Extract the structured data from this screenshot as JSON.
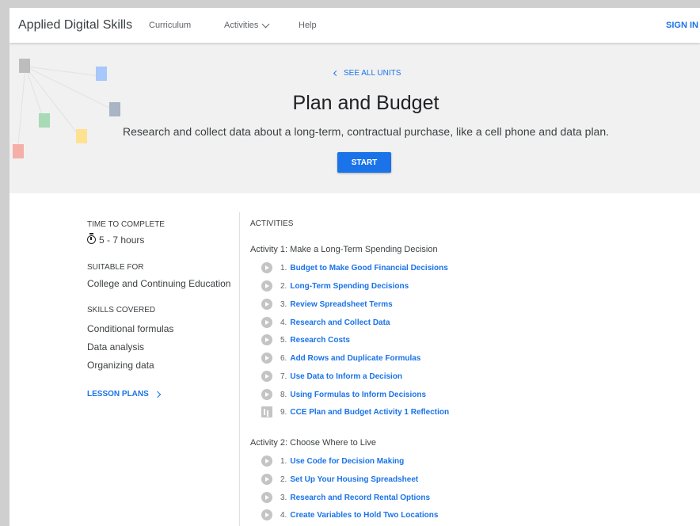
{
  "header": {
    "brand": "Applied Digital Skills",
    "nav": {
      "curriculum": "Curriculum",
      "activities": "Activities",
      "help": "Help"
    },
    "sign_in": "SIGN IN"
  },
  "hero": {
    "see_all": "SEE ALL UNITS",
    "title": "Plan and Budget",
    "subtitle": "Research and collect data about a long-term, contractual purchase, like a cell phone and data plan.",
    "start": "START"
  },
  "details": {
    "time_heading": "TIME TO COMPLETE",
    "time_value": "5 - 7 hours",
    "suitable_heading": "SUITABLE FOR",
    "suitable_value": "College and Continuing Education",
    "skills_heading": "SKILLS COVERED",
    "skills": [
      "Conditional formulas",
      "Data analysis",
      "Organizing data"
    ],
    "lesson_plans": "LESSON PLANS"
  },
  "activities": {
    "heading": "ACTIVITIES",
    "groups": [
      {
        "title": "Activity 1: Make a Long-Term Spending Decision",
        "items": [
          {
            "num": "1.",
            "label": "Budget to Make Good Financial Decisions",
            "icon": "play-icon"
          },
          {
            "num": "2.",
            "label": "Long-Term Spending Decisions",
            "icon": "play-icon"
          },
          {
            "num": "3.",
            "label": "Review Spreadsheet Terms",
            "icon": "play-icon"
          },
          {
            "num": "4.",
            "label": "Research and Collect Data",
            "icon": "play-icon"
          },
          {
            "num": "5.",
            "label": "Research Costs",
            "icon": "play-icon"
          },
          {
            "num": "6.",
            "label": "Add Rows and Duplicate Formulas",
            "icon": "play-icon"
          },
          {
            "num": "7.",
            "label": "Use Data to Inform a Decision",
            "icon": "play-icon"
          },
          {
            "num": "8.",
            "label": "Using Formulas to Inform Decisions",
            "icon": "play-icon"
          },
          {
            "num": "9.",
            "label": "CCE Plan and Budget Activity 1 Reflection",
            "icon": "quiz-icon"
          }
        ]
      },
      {
        "title": "Activity 2: Choose Where to Live",
        "items": [
          {
            "num": "1.",
            "label": "Use Code for Decision Making",
            "icon": "play-icon"
          },
          {
            "num": "2.",
            "label": "Set Up Your Housing Spreadsheet",
            "icon": "play-icon"
          },
          {
            "num": "3.",
            "label": "Research and Record Rental Options",
            "icon": "play-icon"
          },
          {
            "num": "4.",
            "label": "Create Variables to Hold Two Locations",
            "icon": "play-icon"
          }
        ]
      }
    ]
  },
  "colors": {
    "accent": "#1a73e8",
    "hero_bg": "#f1f1f1"
  }
}
